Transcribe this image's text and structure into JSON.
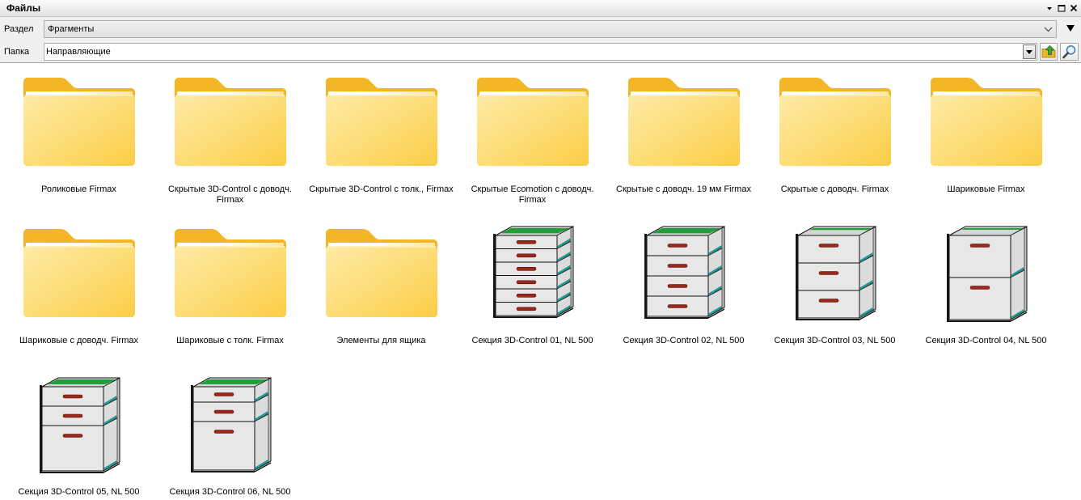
{
  "panel": {
    "title": "Файлы",
    "controls": [
      "menu-arrow-icon",
      "maximize-icon",
      "close-icon"
    ]
  },
  "section": {
    "label": "Раздел",
    "value": "Фрагменты",
    "dropdown_icon": "chevron-down-icon",
    "menu_icon": "triangle-down-icon"
  },
  "folder": {
    "label": "Папка",
    "value": "Направляющие",
    "dropdown_icon": "dropdown-arrow-icon",
    "up_icon": "folder-up-icon",
    "search_icon": "search-icon"
  },
  "items": [
    {
      "label": "Роликовые Firmax",
      "icon": "folder-icon"
    },
    {
      "label": "Скрытые 3D-Control с доводч. Firmax",
      "icon": "folder-icon"
    },
    {
      "label": "Скрытые 3D-Control с толк., Firmax",
      "icon": "folder-icon"
    },
    {
      "label": "Скрытые Ecomotion с доводч. Firmax",
      "icon": "folder-icon"
    },
    {
      "label": "Скрытые с доводч. 19 мм Firmax",
      "icon": "folder-icon"
    },
    {
      "label": "Скрытые с доводч. Firmax",
      "icon": "folder-icon"
    },
    {
      "label": "Шариковые Firmax",
      "icon": "folder-icon"
    },
    {
      "label": "Шариковые с доводч. Firmax",
      "icon": "folder-icon"
    },
    {
      "label": "Шариковые с толк. Firmax",
      "icon": "folder-icon"
    },
    {
      "label": "Элементы для ящика",
      "icon": "folder-icon"
    },
    {
      "label": "Секция 3D-Control 01, NL 500",
      "icon": "drawer-section-icon"
    },
    {
      "label": "Секция 3D-Control 02, NL 500",
      "icon": "drawer-section-icon"
    },
    {
      "label": "Секция 3D-Control 03, NL 500",
      "icon": "drawer-section-icon"
    },
    {
      "label": "Секция 3D-Control 04, NL 500",
      "icon": "drawer-section-icon"
    },
    {
      "label": "Секция 3D-Control 05, NL 500",
      "icon": "drawer-section-icon"
    },
    {
      "label": "Секция 3D-Control 06, NL 500",
      "icon": "drawer-section-icon"
    }
  ],
  "colors": {
    "folder_back": "#f3b627",
    "drawer_front": "#e7e7e7",
    "drawer_interior": "#1f9e3a",
    "handle": "#98281c",
    "runner": "#19a39b"
  }
}
